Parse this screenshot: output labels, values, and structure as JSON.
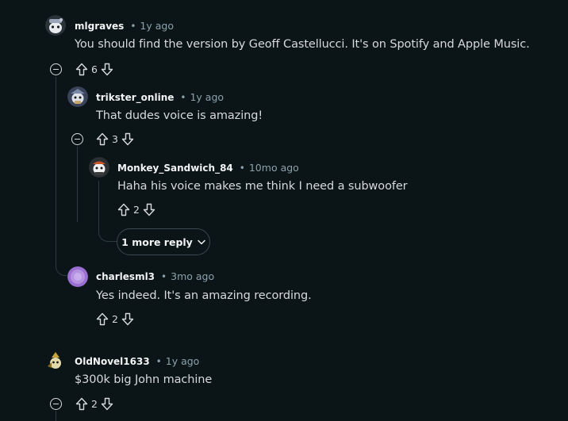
{
  "comments": [
    {
      "username": "mlgraves",
      "age": "1y ago",
      "body": "You should find the version by Geoff Castellucci. It's on Spotify and Apple Music.",
      "votes": "6",
      "avatar_color": "#9aa4b8",
      "avatar_icon": "snoo-avatar"
    },
    {
      "username": "trikster_online",
      "age": "1y ago",
      "body": "That dudes voice is amazing!",
      "votes": "3",
      "avatar_color": "#7a8aa6",
      "avatar_icon": "snoo-avatar"
    },
    {
      "username": "Monkey_Sandwich_84",
      "age": "10mo ago",
      "body": "Haha his voice makes me think I need a subwoofer",
      "votes": "2",
      "avatar_color": "#c8562a",
      "avatar_icon": "snoo-avatar"
    },
    {
      "username": "charlesml3",
      "age": "3mo ago",
      "body": "Yes indeed. It's an amazing recording.",
      "votes": "2",
      "avatar_color": "#9b6fd1",
      "avatar_icon": "default-avatar"
    },
    {
      "username": "OldNovel1633",
      "age": "1y ago",
      "body": "$300k big John machine",
      "votes": "2",
      "avatar_color": "#c9a23a",
      "avatar_icon": "snoo-avatar"
    }
  ],
  "separator": "•",
  "more_replies": {
    "label": "1 more reply",
    "icon": "chevron-down-icon"
  },
  "colors": {
    "background": "#0b1416",
    "thread_line": "#2c3b40",
    "meta_text": "#8ba2ad"
  }
}
